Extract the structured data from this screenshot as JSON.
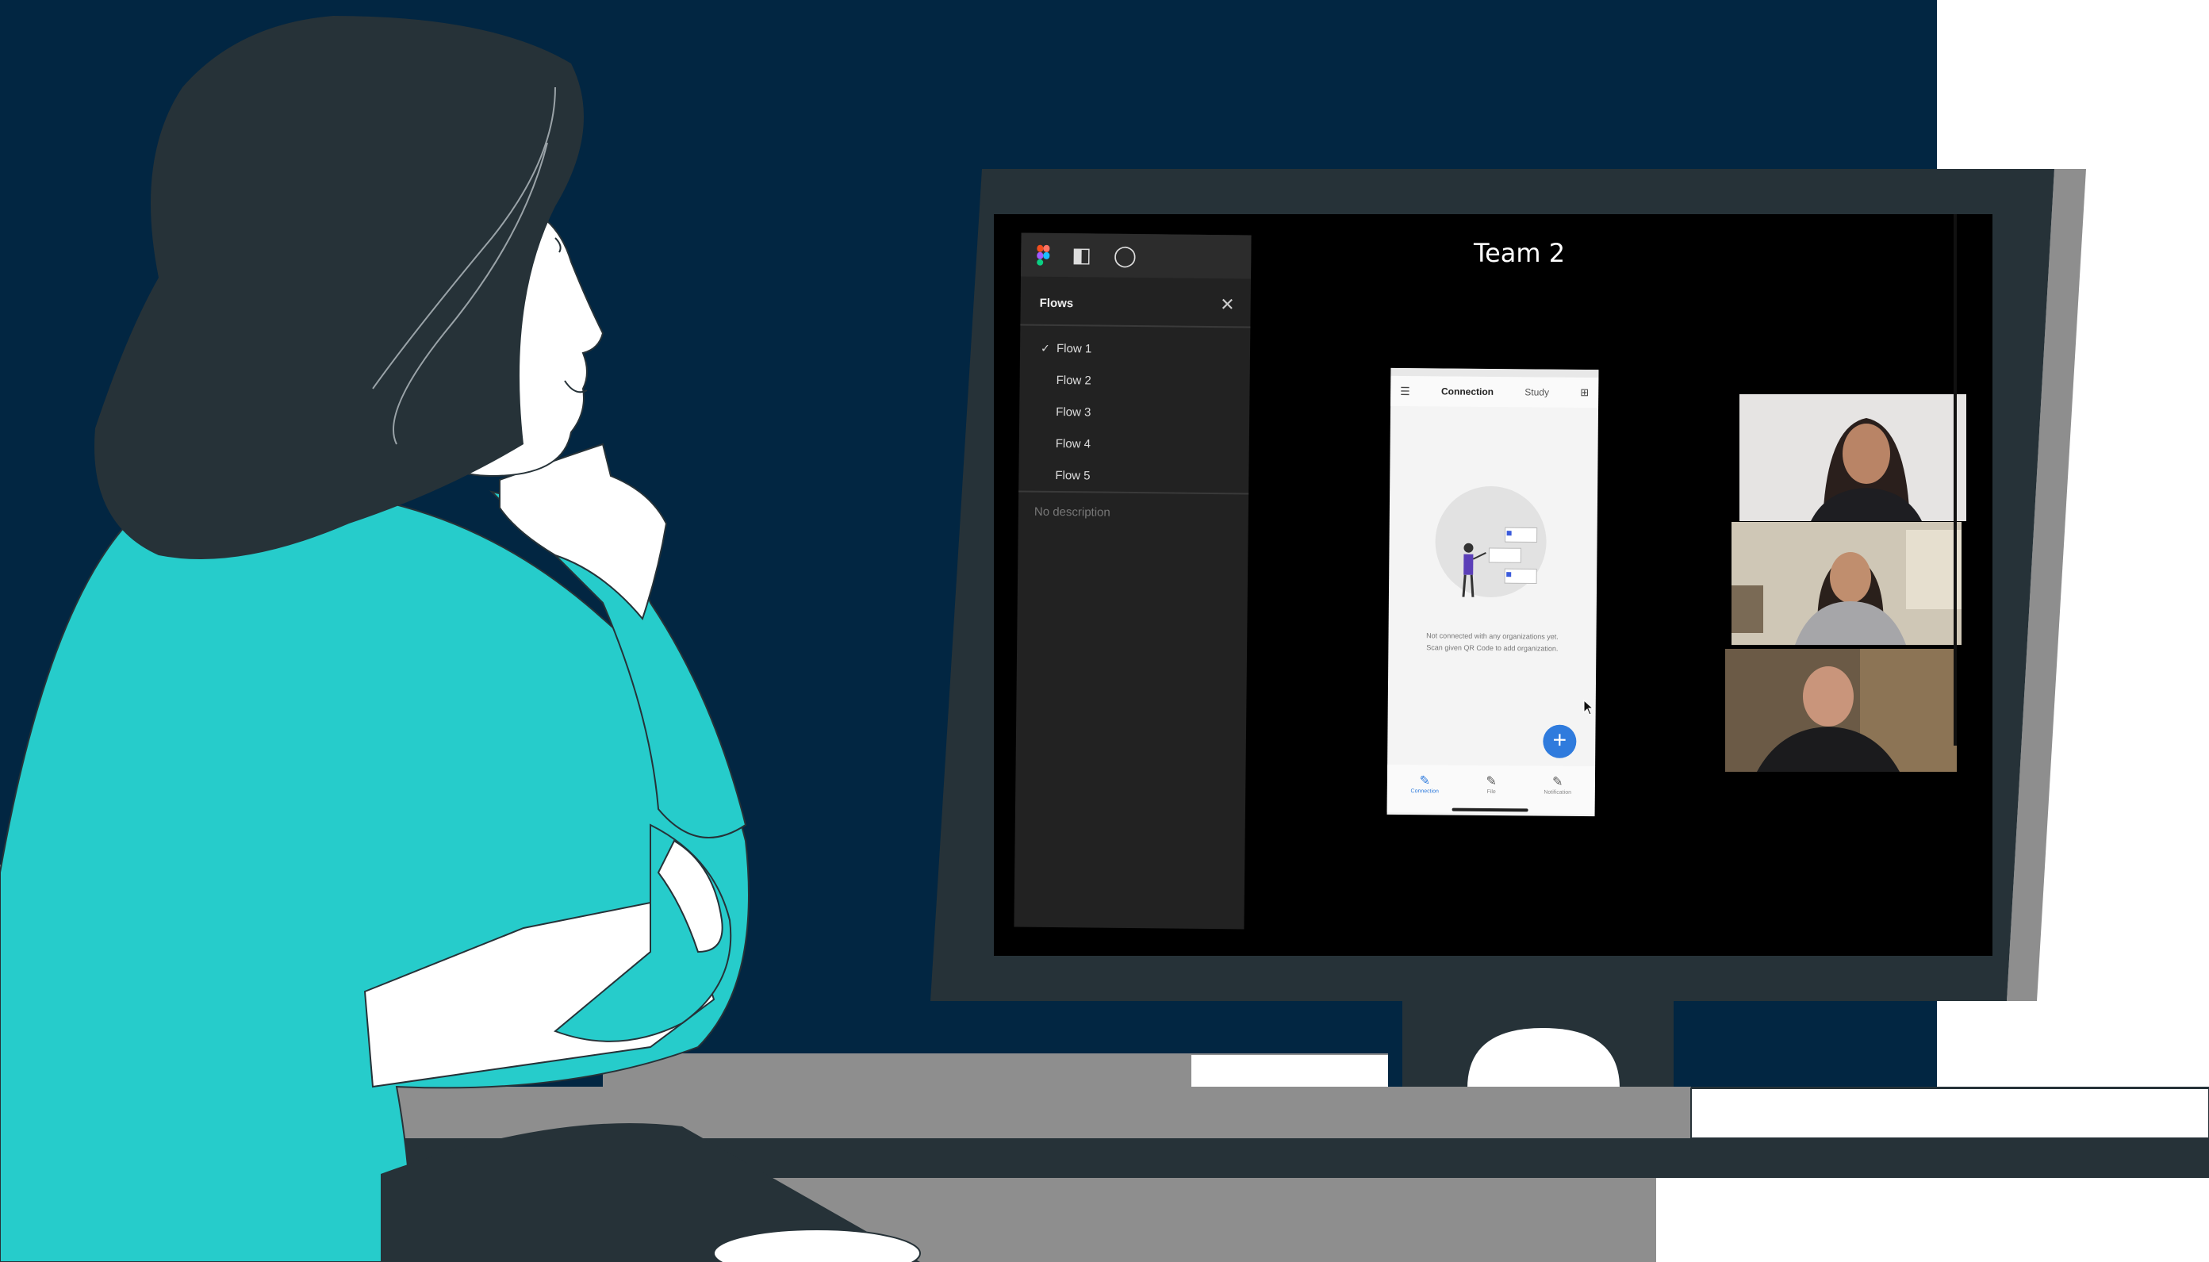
{
  "meeting": {
    "title": "Team 2"
  },
  "figma": {
    "toolbar_icons": [
      "figma-logo-icon",
      "panel-toggle-icon",
      "comment-icon"
    ],
    "flows_title": "Flows",
    "close_glyph": "✕",
    "flows": [
      {
        "label": "Flow 1",
        "checked": true
      },
      {
        "label": "Flow 2",
        "checked": false
      },
      {
        "label": "Flow 3",
        "checked": false
      },
      {
        "label": "Flow 4",
        "checked": false
      },
      {
        "label": "Flow 5",
        "checked": false
      }
    ],
    "description": "No description"
  },
  "phone": {
    "tabs": [
      "Connection",
      "Study"
    ],
    "active_tab": "Connection",
    "message_line1": "Not connected with any organizations yet.",
    "message_line2": "Scan given QR Code to add organization.",
    "fab_label": "+",
    "bottom_nav": [
      "Connection",
      "File",
      "Notification"
    ]
  },
  "participants": [
    "participant-1",
    "participant-2",
    "participant-3"
  ],
  "colors": {
    "background_navy": "#022642",
    "shirt_teal": "#26cccb",
    "hair_dark": "#263238",
    "monitor_frame": "#263238",
    "desk_gray": "#8e8e8e",
    "fab_blue": "#2f7bdd"
  }
}
